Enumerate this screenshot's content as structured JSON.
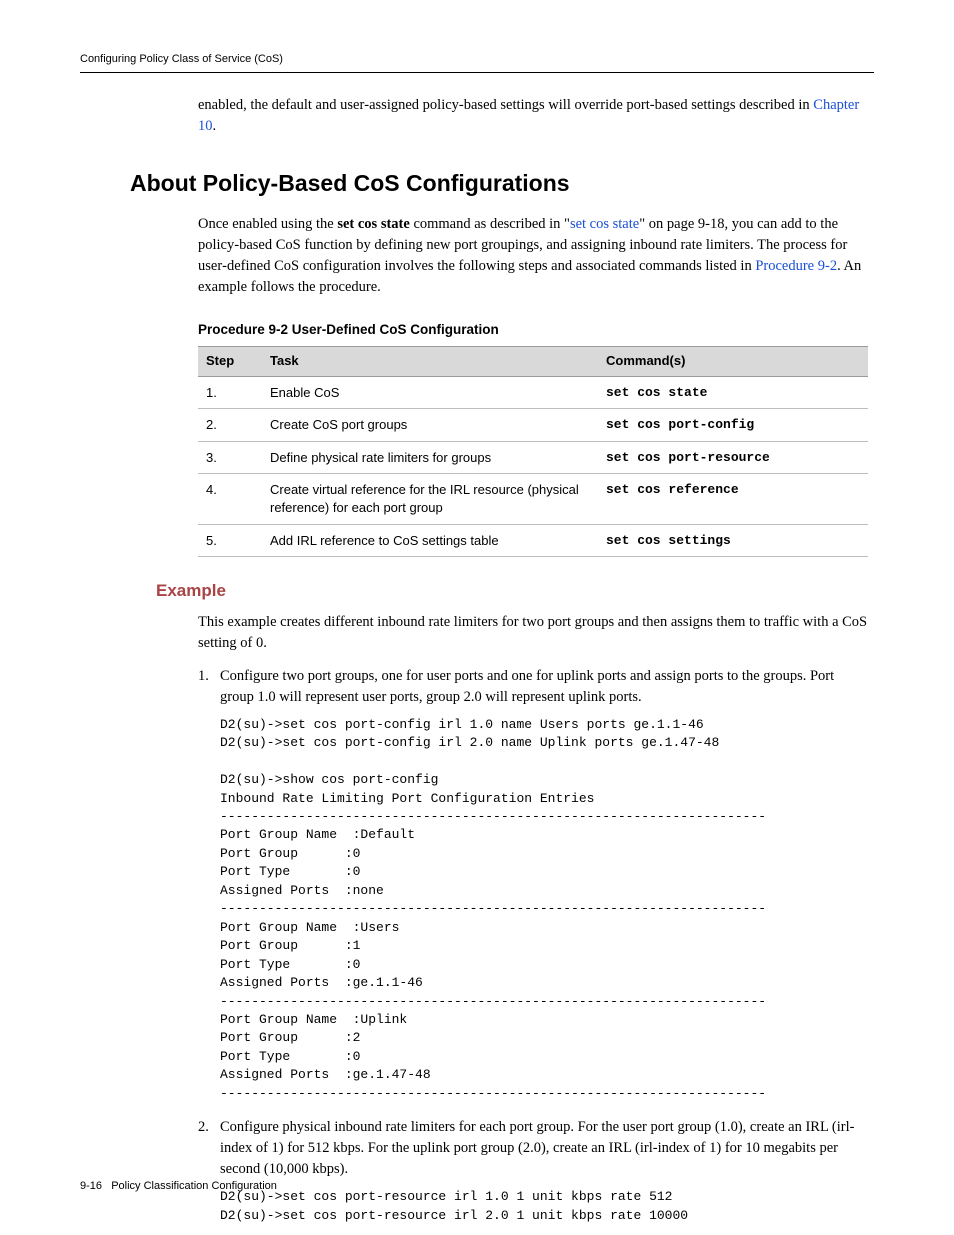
{
  "header": {
    "running_title": "Configuring Policy Class of Service (CoS)"
  },
  "intro_para": {
    "pre": "enabled, the default and user‐assigned policy‐based settings will override port‐based settings described in ",
    "link": "Chapter 10",
    "post": "."
  },
  "section_title": "About Policy-Based CoS Configurations",
  "about_para": {
    "p1a": "Once enabled using the ",
    "p1_cmd": "set cos state",
    "p1b": " command as described in \"",
    "p1_link1": "set cos state",
    "p1c": "\" on page 9‐18, you can add to the policy‐based CoS function by defining new port groupings, and assigning inbound rate limiters. The process for user‐defined CoS configuration involves the following steps and associated commands listed in ",
    "p1_link2": "Procedure 9‐2",
    "p1d": ". An example follows the procedure."
  },
  "table": {
    "title": "Procedure 9-2    User-Defined CoS Configuration",
    "head": {
      "step": "Step",
      "task": "Task",
      "cmd": "Command(s)"
    },
    "rows": [
      {
        "step": "1.",
        "task": "Enable CoS",
        "cmd": "set cos state"
      },
      {
        "step": "2.",
        "task": "Create CoS port groups",
        "cmd": "set cos port-config"
      },
      {
        "step": "3.",
        "task": "Define physical rate limiters for groups",
        "cmd": "set cos port-resource"
      },
      {
        "step": "4.",
        "task": "Create virtual reference for the IRL resource (physical reference) for each port group",
        "cmd": "set cos reference"
      },
      {
        "step": "5.",
        "task": "Add IRL reference to CoS settings table",
        "cmd": "set cos settings"
      }
    ]
  },
  "example": {
    "heading": "Example",
    "intro": "This example creates different inbound rate limiters for two port groups and then assigns them to traffic with a CoS setting of 0.",
    "steps": [
      {
        "text": "Configure two port groups, one for user ports and one for uplink ports and assign ports to the groups. Port group 1.0 will represent user ports, group 2.0 will represent uplink ports.",
        "code": "D2(su)->set cos port-config irl 1.0 name Users ports ge.1.1-46\nD2(su)->set cos port-config irl 2.0 name Uplink ports ge.1.47-48\n\nD2(su)->show cos port-config\nInbound Rate Limiting Port Configuration Entries\n----------------------------------------------------------------------\nPort Group Name  :Default\nPort Group      :0\nPort Type       :0\nAssigned Ports  :none\n----------------------------------------------------------------------\nPort Group Name  :Users\nPort Group      :1\nPort Type       :0\nAssigned Ports  :ge.1.1-46\n----------------------------------------------------------------------\nPort Group Name  :Uplink\nPort Group      :2\nPort Type       :0\nAssigned Ports  :ge.1.47-48\n----------------------------------------------------------------------"
      },
      {
        "text": "Configure physical inbound rate limiters for each port group. For the user port group (1.0), create an IRL (irl‐index of 1) for 512 kbps. For the uplink port group (2.0), create an IRL (irl‐index of 1) for 10 megabits per second (10,000 kbps).",
        "code": "D2(su)->set cos port-resource irl 1.0 1 unit kbps rate 512\nD2(su)->set cos port-resource irl 2.0 1 unit kbps rate 10000"
      }
    ]
  },
  "footer": {
    "page": "9-16",
    "title": "Policy Classification Configuration"
  }
}
